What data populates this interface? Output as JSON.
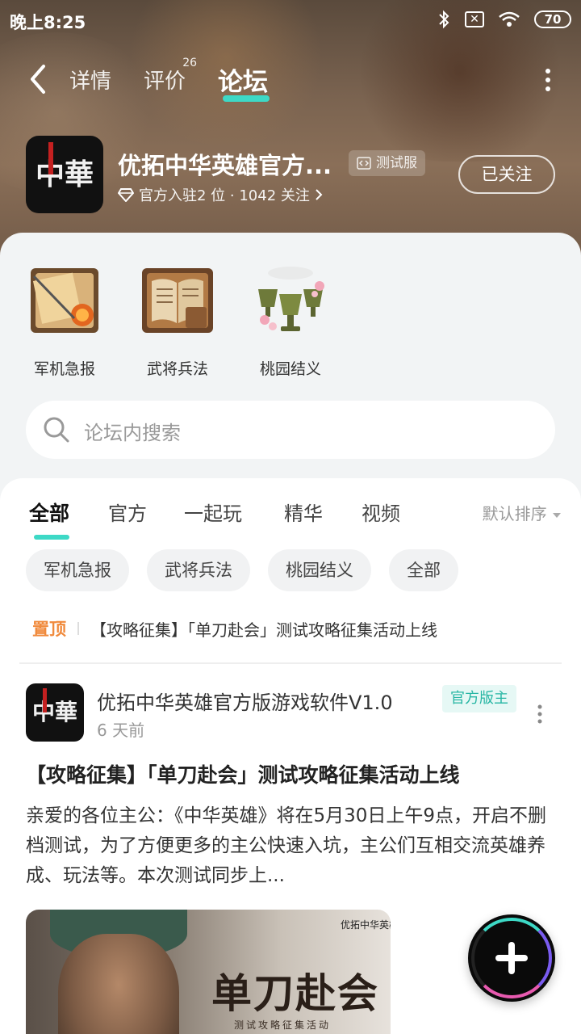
{
  "status_bar": {
    "time": "晚上8:25",
    "battery": "70"
  },
  "nav": {
    "tabs": [
      {
        "label": "详情"
      },
      {
        "label": "评价",
        "badge": "26"
      },
      {
        "label": "论坛"
      }
    ],
    "active_tab": "论坛"
  },
  "app": {
    "name": "优拓中华英雄官方...",
    "test_tag": "测试服",
    "meta": "官方入驻2 位 · 1042 关注",
    "follow_label": "已关注",
    "logo_text": "中華"
  },
  "categories": [
    {
      "label": "军机急报"
    },
    {
      "label": "武将兵法"
    },
    {
      "label": "桃园结义"
    }
  ],
  "search": {
    "placeholder": "论坛内搜索"
  },
  "feed_tabs": [
    {
      "label": "全部"
    },
    {
      "label": "官方"
    },
    {
      "label": "一起玩"
    },
    {
      "label": "精华"
    },
    {
      "label": "视频"
    }
  ],
  "sort_label": "默认排序",
  "chips": [
    {
      "label": "军机急报"
    },
    {
      "label": "武将兵法"
    },
    {
      "label": "桃园结义"
    },
    {
      "label": "全部"
    }
  ],
  "pinned": {
    "tag": "置顶",
    "text": "【攻略征集】「单刀赴会」测试攻略征集活动上线"
  },
  "post": {
    "author": "优拓中华英雄官方版游戏软件V1.0",
    "role": "官方版主",
    "time": "6 天前",
    "title": "【攻略征集】「单刀赴会」测试攻略征集活动上线",
    "body": "亲爱的各位主公：《中华英雄》将在5月30日上午9点，开启不删档测试，为了方便更多的主公快速入坑，主公们互相交流英雄养成、玩法等。本次测试同步上...",
    "cover": {
      "headline": "单刀赴会",
      "subtitle": "测试攻略征集活动",
      "brand": "优拓中华英雄"
    }
  },
  "colors": {
    "accent": "#3dd9c6",
    "pinned": "#f08a3c",
    "role_text": "#27b6a4"
  }
}
